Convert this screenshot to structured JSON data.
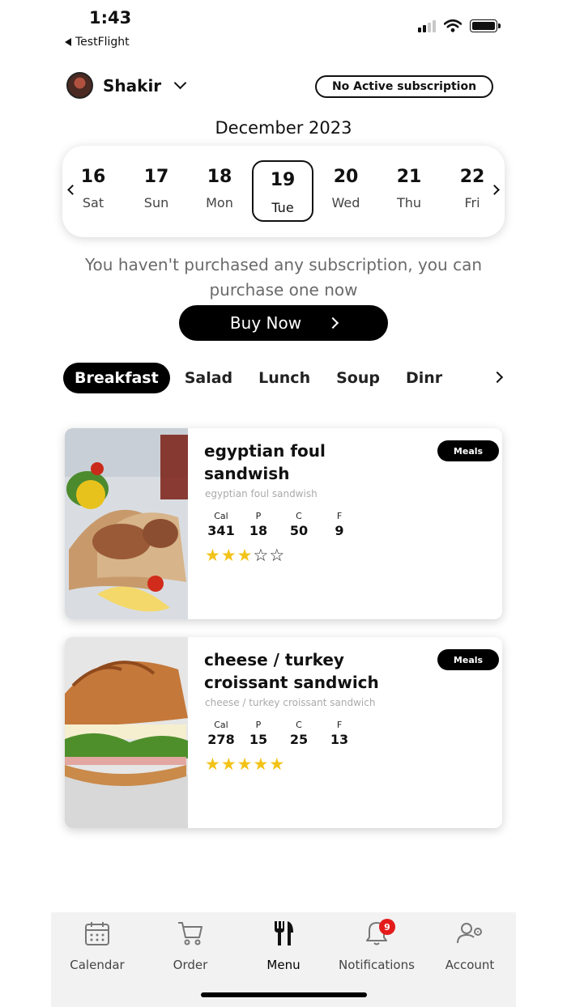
{
  "status_bar": {
    "time": "1:43",
    "back_app": "TestFlight"
  },
  "header": {
    "user_name": "Shakir",
    "subscription_status": "No Active subscription"
  },
  "calendar": {
    "month": "December 2023",
    "days": [
      {
        "num": "16",
        "dow": "Sat"
      },
      {
        "num": "17",
        "dow": "Sun"
      },
      {
        "num": "18",
        "dow": "Mon"
      },
      {
        "num": "19",
        "dow": "Tue",
        "selected": true
      },
      {
        "num": "20",
        "dow": "Wed"
      },
      {
        "num": "21",
        "dow": "Thu"
      },
      {
        "num": "22",
        "dow": "Fri"
      }
    ]
  },
  "notice": {
    "text": "You haven't purchased any subscription, you can purchase one now",
    "button": "Buy Now"
  },
  "categories": [
    "Breakfast",
    "Salad",
    "Lunch",
    "Soup",
    "Dinr"
  ],
  "active_category": "Breakfast",
  "meals": [
    {
      "title": "egyptian foul sandwish",
      "subtitle": "egyptian foul sandwish",
      "badge": "Meals",
      "macro_labels": [
        "Cal",
        "P",
        "C",
        "F"
      ],
      "macros": [
        "341",
        "18",
        "50",
        "9"
      ],
      "rating": 3,
      "max_rating": 5
    },
    {
      "title": "cheese / turkey croissant sandwich",
      "subtitle": "cheese / turkey croissant sandwich",
      "badge": "Meals",
      "macro_labels": [
        "Cal",
        "P",
        "C",
        "F"
      ],
      "macros": [
        "278",
        "15",
        "25",
        "13"
      ],
      "rating": 5,
      "max_rating": 5
    }
  ],
  "tabbar": {
    "items": [
      {
        "label": "Calendar",
        "icon": "calendar-icon"
      },
      {
        "label": "Order",
        "icon": "cart-icon"
      },
      {
        "label": "Menu",
        "icon": "fork-knife-icon",
        "active": true
      },
      {
        "label": "Notifications",
        "icon": "bell-icon",
        "badge": "9"
      },
      {
        "label": "Account",
        "icon": "user-settings-icon"
      }
    ]
  },
  "colors": {
    "accent": "#000000",
    "star": "#f2c318",
    "badge_red": "#e41b1b"
  }
}
